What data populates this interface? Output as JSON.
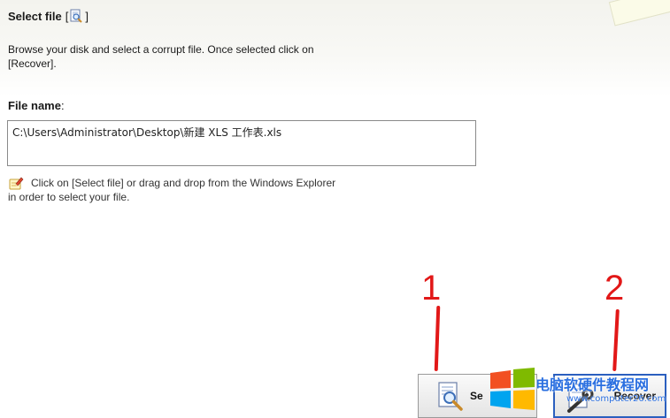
{
  "colors": {
    "annotation": "#e21818",
    "recover_border": "#2b5fbf",
    "watermark": "#2a6fe0"
  },
  "header": {
    "title": "Select file",
    "bracket_open": "[",
    "bracket_close": "]",
    "icon": "magnifier-document-icon"
  },
  "intro": {
    "text": "Browse your disk and select a corrupt file. Once selected click on [Recover]."
  },
  "file": {
    "label": "File name",
    "label_suffix": ":",
    "value": "C:\\Users\\Administrator\\Desktop\\新建 XLS 工作表.xls"
  },
  "hint": {
    "icon": "pencil-note-icon",
    "text": "Click on [Select file] or drag and drop from the Windows Explorer in order to select your file."
  },
  "annotations": {
    "one": "1",
    "two": "2"
  },
  "buttons": {
    "select": {
      "visible_label": "Se",
      "icon": "magnifier-document-icon"
    },
    "recover": {
      "label": "Recover",
      "icon": "wrench-document-icon"
    }
  },
  "watermark": {
    "text": "电脑软硬件教程网",
    "url": "www.computer26.com"
  }
}
